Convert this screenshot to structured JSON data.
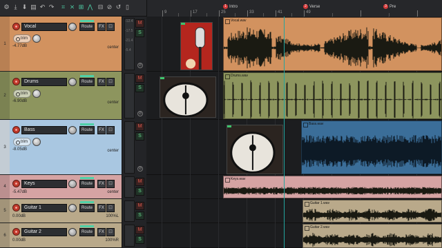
{
  "colors": {
    "vocal": "#d2925f",
    "drums": "#8d955e",
    "bass": "#a9c7e1",
    "keys": "#d5a3a3",
    "guitar": "#b9a98a",
    "record": "#c0392b",
    "accent": "#4fd1a8",
    "marker": "#d43a3a"
  },
  "toolbar": {
    "icons": [
      "settings-icon",
      "undo-icon",
      "save-icon",
      "render-icon",
      "undo-left-icon",
      "redo-icon",
      "snap-icon",
      "ripple-icon",
      "grid-icon",
      "group-icon",
      "envelope-icon",
      "metronome-icon",
      "loop-icon",
      "trim-icon"
    ]
  },
  "ruler": {
    "bars": [
      "9",
      "17",
      "25",
      "33",
      "41",
      "49"
    ],
    "markers": [
      {
        "num": "1",
        "label": "Intro"
      },
      {
        "num": "2",
        "label": "Verse"
      },
      {
        "num": "3",
        "label": "Pre"
      }
    ]
  },
  "tracks": [
    {
      "num": "1",
      "name": "Vocal",
      "volume": "-4.77dB",
      "pan": "center",
      "route": "Route",
      "fx": "FX",
      "trim": "trim",
      "mute": "M",
      "solo": "S",
      "item": "Vocal.wav",
      "color": "vocal"
    },
    {
      "num": "2",
      "name": "Drums",
      "volume": "-6.90dB",
      "pan": "center",
      "route": "Route",
      "fx": "FX",
      "trim": "trim",
      "mute": "M",
      "solo": "S",
      "item": "Drums.wav",
      "color": "drums"
    },
    {
      "num": "3",
      "name": "Bass",
      "volume": "-8.05dB",
      "pan": "center",
      "route": "Route",
      "fx": "FX",
      "trim": "trim",
      "mute": "M",
      "solo": "S",
      "item": "Bass.wav",
      "color": "bass"
    },
    {
      "num": "4",
      "name": "Keys",
      "volume": "-5.47dB",
      "pan": "center",
      "route": "Route",
      "fx": "FX",
      "trim": "",
      "mute": "M",
      "solo": "S",
      "item": "Keys.wav",
      "color": "keys"
    },
    {
      "num": "5",
      "name": "Guitar 1",
      "volume": "0.00dB",
      "pan": "100%L",
      "route": "Route",
      "fx": "FX",
      "trim": "",
      "mute": "M",
      "solo": "S",
      "item": "Guitar 1.wav",
      "color": "guitar"
    },
    {
      "num": "6",
      "name": "Guitar 2",
      "volume": "0.00dB",
      "pan": "100%R",
      "route": "Route",
      "fx": "FX",
      "trim": "",
      "mute": "M",
      "solo": "S",
      "item": "Guitar 2.wav",
      "color": "guitar"
    }
  ],
  "meters": {
    "scale": [
      "-12.4",
      "-17.5",
      "-21.4",
      "-5.4"
    ]
  }
}
